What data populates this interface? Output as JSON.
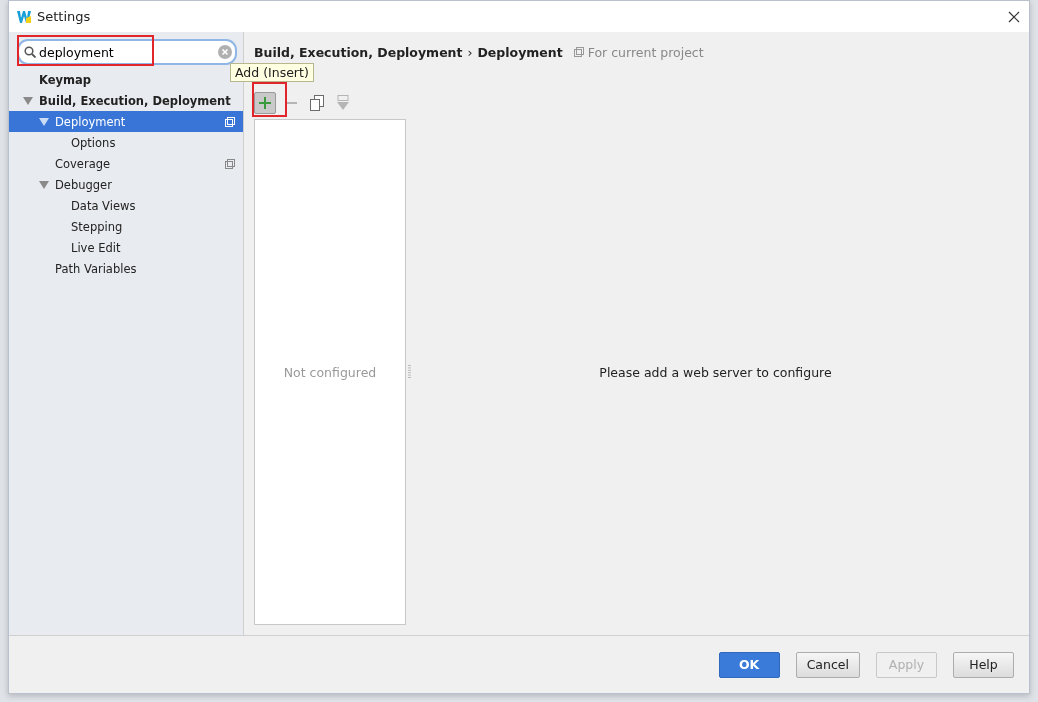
{
  "window": {
    "title": "Settings"
  },
  "search": {
    "value": "deployment"
  },
  "tree": [
    {
      "label": "Keymap",
      "selected": false,
      "project_scoped": false
    },
    {
      "label": "Build, Execution, Deployment",
      "selected": false,
      "expanded": true,
      "project_scoped": false,
      "children": [
        {
          "label": "Deployment",
          "selected": true,
          "expanded": true,
          "project_scoped": true,
          "children": [
            {
              "label": "Options",
              "selected": false,
              "project_scoped": false
            }
          ]
        },
        {
          "label": "Coverage",
          "selected": false,
          "project_scoped": true
        },
        {
          "label": "Debugger",
          "selected": false,
          "expanded": true,
          "project_scoped": false,
          "children": [
            {
              "label": "Data Views",
              "selected": false,
              "project_scoped": false
            },
            {
              "label": "Stepping",
              "selected": false,
              "project_scoped": false
            },
            {
              "label": "Live Edit",
              "selected": false,
              "project_scoped": false
            }
          ]
        },
        {
          "label": "Path Variables",
          "selected": false,
          "project_scoped": false
        }
      ]
    }
  ],
  "breadcrumb": {
    "parent": "Build, Execution, Deployment",
    "separator": "›",
    "current": "Deployment",
    "scope": "For current project"
  },
  "toolbar": [
    {
      "kind": "add",
      "hovered": true,
      "disabled": false
    },
    {
      "kind": "remove",
      "hovered": false,
      "disabled": true
    },
    {
      "kind": "copy",
      "hovered": false,
      "disabled": false
    },
    {
      "kind": "move",
      "hovered": false,
      "disabled": true
    }
  ],
  "tooltip": "Add (Insert)",
  "server_list": {
    "empty_text": "Not configured"
  },
  "detail": {
    "message": "Please add a web server to configure"
  },
  "buttons": [
    {
      "label": "OK",
      "default": true,
      "disabled": false
    },
    {
      "label": "Cancel",
      "default": false,
      "disabled": false
    },
    {
      "label": "Apply",
      "default": false,
      "disabled": true
    },
    {
      "label": "Help",
      "default": false,
      "disabled": false
    }
  ]
}
